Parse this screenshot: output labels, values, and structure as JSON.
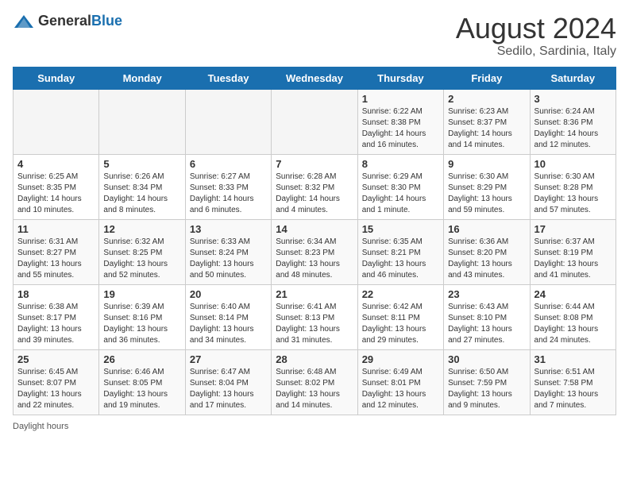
{
  "header": {
    "logo_general": "General",
    "logo_blue": "Blue",
    "title": "August 2024",
    "location": "Sedilo, Sardinia, Italy"
  },
  "calendar": {
    "weekdays": [
      "Sunday",
      "Monday",
      "Tuesday",
      "Wednesday",
      "Thursday",
      "Friday",
      "Saturday"
    ],
    "weeks": [
      [
        {
          "day": "",
          "info": ""
        },
        {
          "day": "",
          "info": ""
        },
        {
          "day": "",
          "info": ""
        },
        {
          "day": "",
          "info": ""
        },
        {
          "day": "1",
          "info": "Sunrise: 6:22 AM\nSunset: 8:38 PM\nDaylight: 14 hours and 16 minutes."
        },
        {
          "day": "2",
          "info": "Sunrise: 6:23 AM\nSunset: 8:37 PM\nDaylight: 14 hours and 14 minutes."
        },
        {
          "day": "3",
          "info": "Sunrise: 6:24 AM\nSunset: 8:36 PM\nDaylight: 14 hours and 12 minutes."
        }
      ],
      [
        {
          "day": "4",
          "info": "Sunrise: 6:25 AM\nSunset: 8:35 PM\nDaylight: 14 hours and 10 minutes."
        },
        {
          "day": "5",
          "info": "Sunrise: 6:26 AM\nSunset: 8:34 PM\nDaylight: 14 hours and 8 minutes."
        },
        {
          "day": "6",
          "info": "Sunrise: 6:27 AM\nSunset: 8:33 PM\nDaylight: 14 hours and 6 minutes."
        },
        {
          "day": "7",
          "info": "Sunrise: 6:28 AM\nSunset: 8:32 PM\nDaylight: 14 hours and 4 minutes."
        },
        {
          "day": "8",
          "info": "Sunrise: 6:29 AM\nSunset: 8:30 PM\nDaylight: 14 hours and 1 minute."
        },
        {
          "day": "9",
          "info": "Sunrise: 6:30 AM\nSunset: 8:29 PM\nDaylight: 13 hours and 59 minutes."
        },
        {
          "day": "10",
          "info": "Sunrise: 6:30 AM\nSunset: 8:28 PM\nDaylight: 13 hours and 57 minutes."
        }
      ],
      [
        {
          "day": "11",
          "info": "Sunrise: 6:31 AM\nSunset: 8:27 PM\nDaylight: 13 hours and 55 minutes."
        },
        {
          "day": "12",
          "info": "Sunrise: 6:32 AM\nSunset: 8:25 PM\nDaylight: 13 hours and 52 minutes."
        },
        {
          "day": "13",
          "info": "Sunrise: 6:33 AM\nSunset: 8:24 PM\nDaylight: 13 hours and 50 minutes."
        },
        {
          "day": "14",
          "info": "Sunrise: 6:34 AM\nSunset: 8:23 PM\nDaylight: 13 hours and 48 minutes."
        },
        {
          "day": "15",
          "info": "Sunrise: 6:35 AM\nSunset: 8:21 PM\nDaylight: 13 hours and 46 minutes."
        },
        {
          "day": "16",
          "info": "Sunrise: 6:36 AM\nSunset: 8:20 PM\nDaylight: 13 hours and 43 minutes."
        },
        {
          "day": "17",
          "info": "Sunrise: 6:37 AM\nSunset: 8:19 PM\nDaylight: 13 hours and 41 minutes."
        }
      ],
      [
        {
          "day": "18",
          "info": "Sunrise: 6:38 AM\nSunset: 8:17 PM\nDaylight: 13 hours and 39 minutes."
        },
        {
          "day": "19",
          "info": "Sunrise: 6:39 AM\nSunset: 8:16 PM\nDaylight: 13 hours and 36 minutes."
        },
        {
          "day": "20",
          "info": "Sunrise: 6:40 AM\nSunset: 8:14 PM\nDaylight: 13 hours and 34 minutes."
        },
        {
          "day": "21",
          "info": "Sunrise: 6:41 AM\nSunset: 8:13 PM\nDaylight: 13 hours and 31 minutes."
        },
        {
          "day": "22",
          "info": "Sunrise: 6:42 AM\nSunset: 8:11 PM\nDaylight: 13 hours and 29 minutes."
        },
        {
          "day": "23",
          "info": "Sunrise: 6:43 AM\nSunset: 8:10 PM\nDaylight: 13 hours and 27 minutes."
        },
        {
          "day": "24",
          "info": "Sunrise: 6:44 AM\nSunset: 8:08 PM\nDaylight: 13 hours and 24 minutes."
        }
      ],
      [
        {
          "day": "25",
          "info": "Sunrise: 6:45 AM\nSunset: 8:07 PM\nDaylight: 13 hours and 22 minutes."
        },
        {
          "day": "26",
          "info": "Sunrise: 6:46 AM\nSunset: 8:05 PM\nDaylight: 13 hours and 19 minutes."
        },
        {
          "day": "27",
          "info": "Sunrise: 6:47 AM\nSunset: 8:04 PM\nDaylight: 13 hours and 17 minutes."
        },
        {
          "day": "28",
          "info": "Sunrise: 6:48 AM\nSunset: 8:02 PM\nDaylight: 13 hours and 14 minutes."
        },
        {
          "day": "29",
          "info": "Sunrise: 6:49 AM\nSunset: 8:01 PM\nDaylight: 13 hours and 12 minutes."
        },
        {
          "day": "30",
          "info": "Sunrise: 6:50 AM\nSunset: 7:59 PM\nDaylight: 13 hours and 9 minutes."
        },
        {
          "day": "31",
          "info": "Sunrise: 6:51 AM\nSunset: 7:58 PM\nDaylight: 13 hours and 7 minutes."
        }
      ]
    ]
  },
  "footer": {
    "note": "Daylight hours"
  }
}
